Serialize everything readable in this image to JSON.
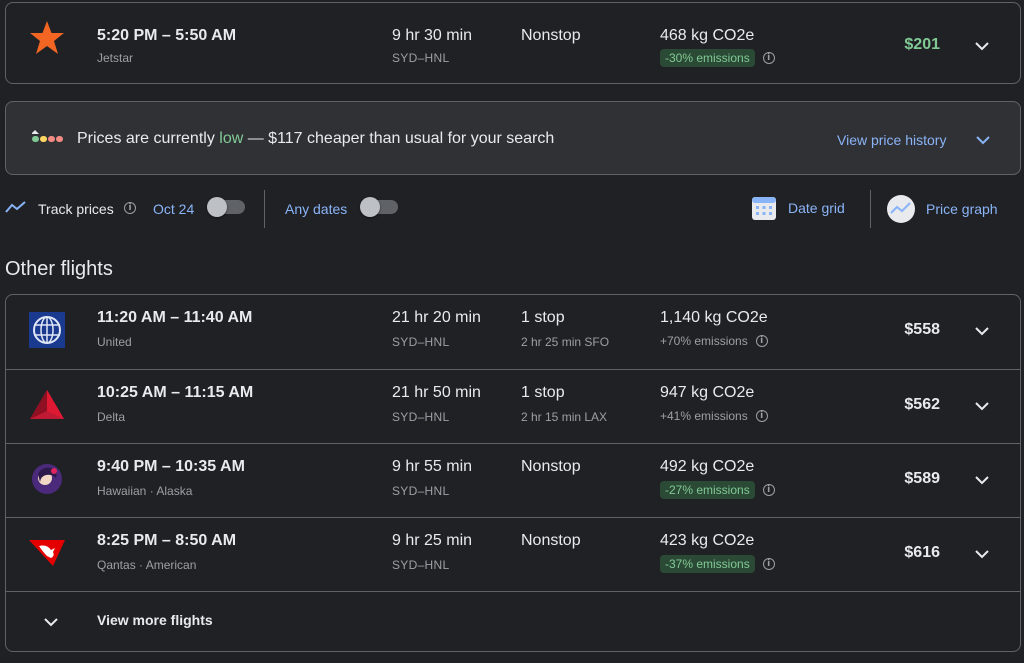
{
  "best_flight": {
    "times": "5:20 PM – 5:50 AM",
    "airline": "Jetstar",
    "duration": "9 hr 30 min",
    "route": "SYD–HNL",
    "stops": "Nonstop",
    "layover": "",
    "co2": "468 kg CO2e",
    "emissions": "-30% emissions",
    "emissions_good": true,
    "price": "$201",
    "logo": "jetstar-star-logo"
  },
  "price_insight": {
    "prefix": "Prices are currently ",
    "level": "low",
    "suffix": " — $117 cheaper than usual for your search",
    "link": "View price history",
    "icon": "price-level-bars-icon"
  },
  "tools": {
    "track_label": "Track prices",
    "track_date": "Oct 24",
    "any_dates": "Any dates",
    "date_grid": "Date grid",
    "price_graph": "Price graph"
  },
  "other_flights": {
    "title": "Other flights",
    "more_label": "View more flights",
    "items": [
      {
        "times": "11:20 AM – 11:40 AM",
        "airline": "United",
        "duration": "21 hr 20 min",
        "route": "SYD–HNL",
        "stops": "1 stop",
        "layover": "2 hr 25 min SFO",
        "co2": "1,140 kg CO2e",
        "emissions": "+70% emissions",
        "price": "$558",
        "logo": "united-globe-logo"
      },
      {
        "times": "10:25 AM – 11:15 AM",
        "airline": "Delta",
        "duration": "21 hr 50 min",
        "route": "SYD–HNL",
        "stops": "1 stop",
        "layover": "2 hr 15 min LAX",
        "co2": "947 kg CO2e",
        "emissions": "+41% emissions",
        "price": "$562",
        "logo": "delta-triangle-logo"
      },
      {
        "times": "9:40 PM – 10:35 AM",
        "airline": "Hawaiian · Alaska",
        "duration": "9 hr 55 min",
        "route": "SYD–HNL",
        "stops": "Nonstop",
        "layover": "",
        "co2": "492 kg CO2e",
        "emissions": "-27% emissions",
        "price": "$589",
        "logo": "hawaiian-pualani-logo"
      },
      {
        "times": "8:25 PM – 8:50 AM",
        "airline": "Qantas · American",
        "duration": "9 hr 25 min",
        "route": "SYD–HNL",
        "stops": "Nonstop",
        "layover": "",
        "co2": "423 kg CO2e",
        "emissions": "-37% emissions",
        "price": "$616",
        "logo": "qantas-kangaroo-logo"
      }
    ]
  },
  "colors": {
    "background": "#202124",
    "accent_blue": "#8ab4f8",
    "good_green": "#81c995",
    "emissions_badge": "#2b4a35",
    "border": "#5f6368"
  }
}
